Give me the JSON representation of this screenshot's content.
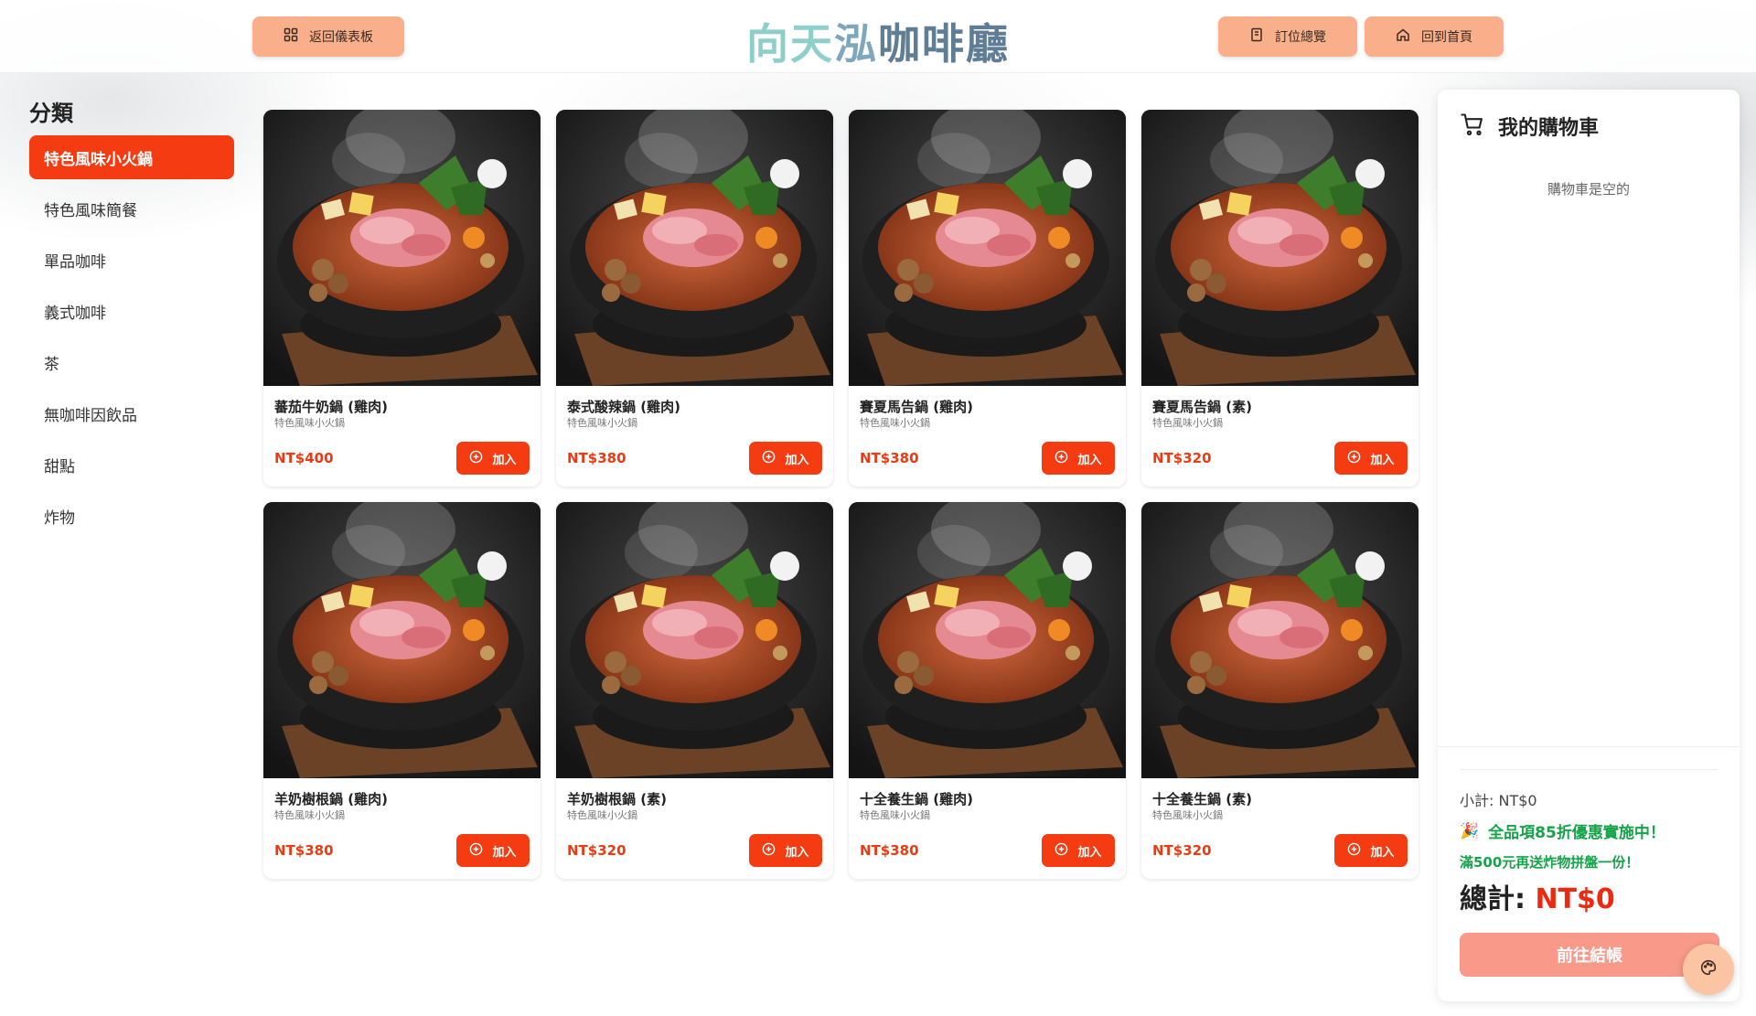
{
  "header": {
    "title_parts": [
      "向天",
      "泓",
      "咖啡廳"
    ],
    "dashboard_label": "返回儀表板",
    "reservations_label": "訂位總覽",
    "home_label": "回到首頁",
    "dashboard_icon": "grid-icon",
    "reservations_icon": "clipboard-icon",
    "home_icon": "home-icon"
  },
  "sidebar": {
    "title": "分類",
    "items": [
      {
        "label": "特色風味小火鍋",
        "active": true
      },
      {
        "label": "特色風味簡餐",
        "active": false
      },
      {
        "label": "單品咖啡",
        "active": false
      },
      {
        "label": "義式咖啡",
        "active": false
      },
      {
        "label": "茶",
        "active": false
      },
      {
        "label": "無咖啡因飲品",
        "active": false
      },
      {
        "label": "甜點",
        "active": false
      },
      {
        "label": "炸物",
        "active": false
      }
    ]
  },
  "products": [
    {
      "name": "蕃茄牛奶鍋 (雞肉)",
      "category": "特色風味小火鍋",
      "price": "NT$400",
      "add_label": "加入"
    },
    {
      "name": "泰式酸辣鍋 (雞肉)",
      "category": "特色風味小火鍋",
      "price": "NT$380",
      "add_label": "加入"
    },
    {
      "name": "賽夏馬告鍋 (雞肉)",
      "category": "特色風味小火鍋",
      "price": "NT$380",
      "add_label": "加入"
    },
    {
      "name": "賽夏馬告鍋 (素)",
      "category": "特色風味小火鍋",
      "price": "NT$320",
      "add_label": "加入"
    },
    {
      "name": "羊奶樹根鍋 (雞肉)",
      "category": "特色風味小火鍋",
      "price": "NT$380",
      "add_label": "加入"
    },
    {
      "name": "羊奶樹根鍋 (素)",
      "category": "特色風味小火鍋",
      "price": "NT$320",
      "add_label": "加入"
    },
    {
      "name": "十全養生鍋 (雞肉)",
      "category": "特色風味小火鍋",
      "price": "NT$380",
      "add_label": "加入"
    },
    {
      "name": "十全養生鍋 (素)",
      "category": "特色風味小火鍋",
      "price": "NT$320",
      "add_label": "加入"
    }
  ],
  "cart": {
    "title": "我的購物車",
    "empty_text": "購物車是空的",
    "subtotal": "小計: NT$0",
    "promo_emoji": "🎉",
    "promo_line1": "全品項85折優惠實施中！",
    "promo_line2": "滿500元再送炸物拼盤一份！",
    "total_label": "總計:",
    "total_amount": "NT$0",
    "checkout_label": "前往結帳"
  },
  "colors": {
    "accent": "#f53b12",
    "header_button": "#f9b08a",
    "price": "#ec3b10",
    "promo": "#16a34a",
    "checkout": "#f8998a"
  }
}
